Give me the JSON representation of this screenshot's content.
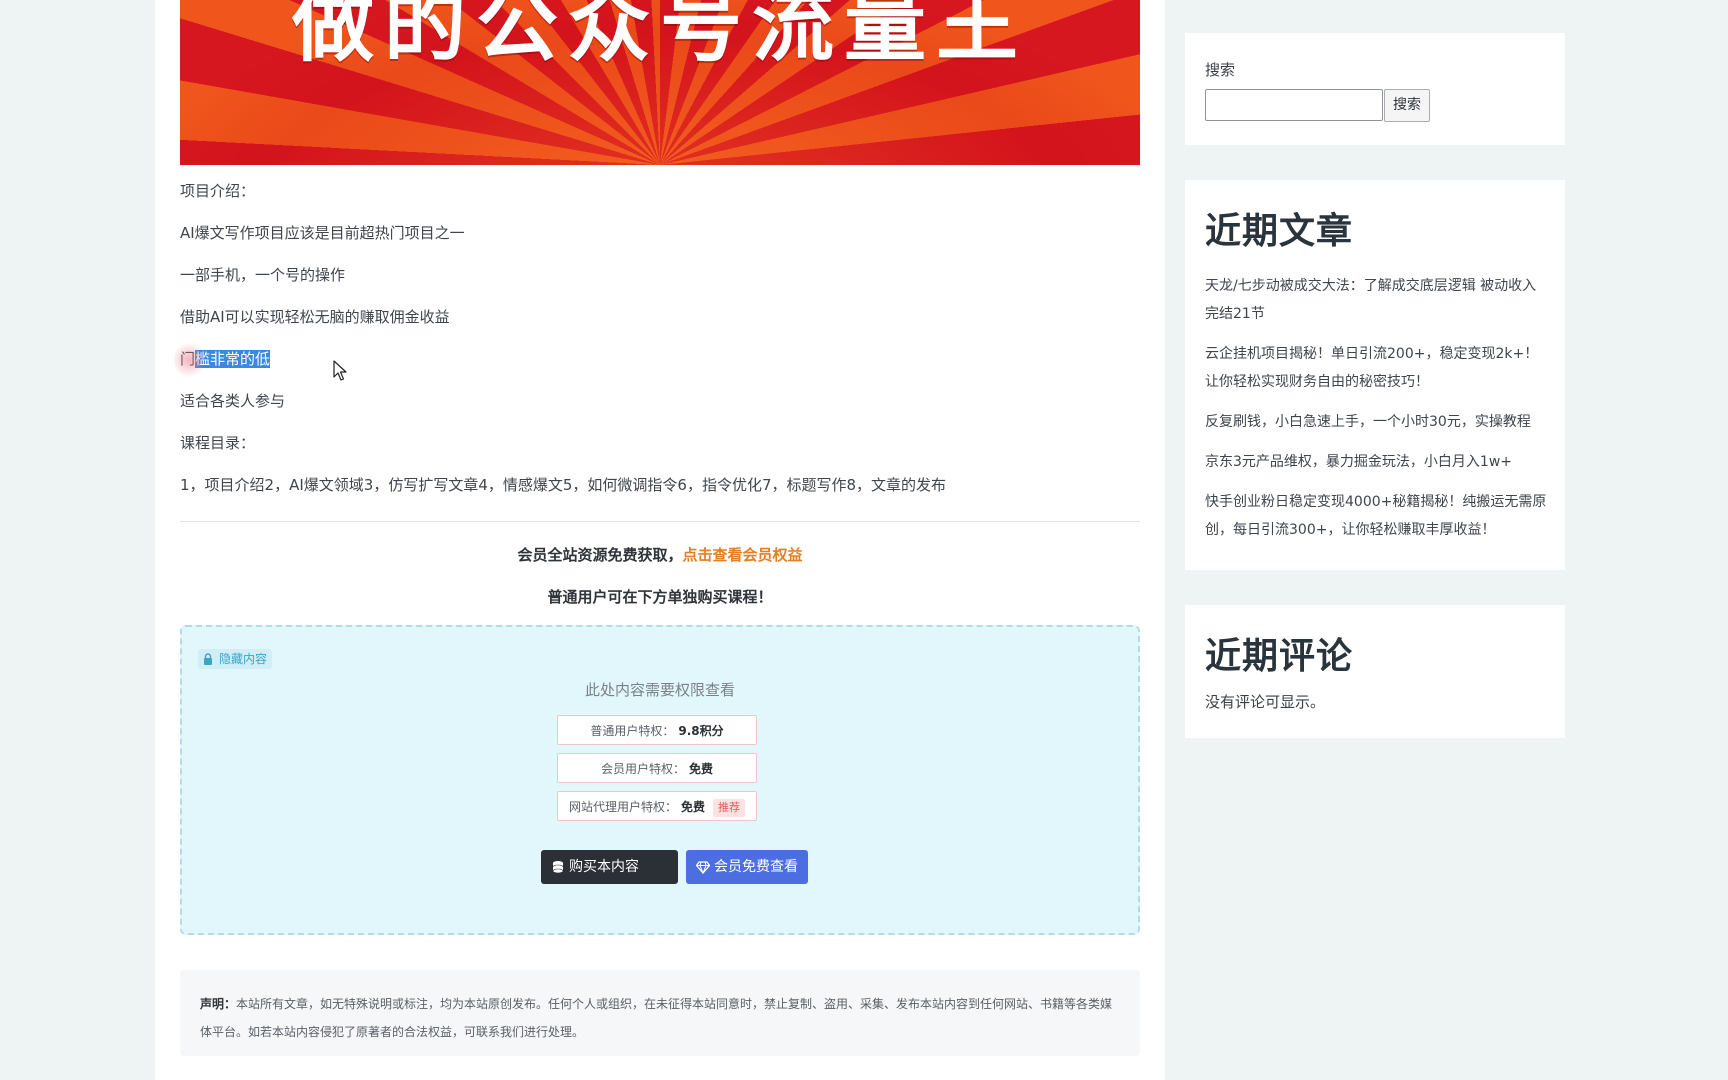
{
  "hero": {
    "title": "做的公众号流量王"
  },
  "article": {
    "paragraphs": [
      "项目介绍：",
      "AI爆文写作项目应该是目前超热门项目之一",
      "一部手机，一个号的操作",
      "借助AI可以实现轻松无脑的赚取佣金收益"
    ],
    "selected_line": {
      "prefix": "门",
      "selected": "槛非常的低"
    },
    "paragraphs_after": [
      "适合各类人参与",
      "课程目录：",
      "1，项目介绍2，AI爆文领域3，仿写扩写文章4，情感爆文5，如何微调指令6，指令优化7，标题写作8，文章的发布"
    ]
  },
  "member": {
    "line1_prefix": "会员全站资源免费获取，",
    "line1_link": "点击查看会员权益",
    "line2": "普通用户可在下方单独购买课程！"
  },
  "hidden": {
    "badge": "隐藏内容",
    "title": "此处内容需要权限查看",
    "rows": [
      {
        "label": "普通用户特权：",
        "value": "9.8积分",
        "tag": ""
      },
      {
        "label": "会员用户特权：",
        "value": "免费",
        "tag": ""
      },
      {
        "label": "网站代理用户特权：",
        "value": "免费",
        "tag": "推荐"
      }
    ],
    "buy_button": "购买本内容",
    "vip_button": "会员免费查看"
  },
  "notice": {
    "label": "声明：",
    "text": "本站所有文章，如无特殊说明或标注，均为本站原创发布。任何个人或组织，在未征得本站同意时，禁止复制、盗用、采集、发布本站内容到任何网站、书籍等各类媒体平台。如若本站内容侵犯了原著者的合法权益，可联系我们进行处理。"
  },
  "sidebar": {
    "search_label": "搜索",
    "search_placeholder": "",
    "search_button": "搜索",
    "recent_title": "近期文章",
    "recent_posts": [
      "天龙/七步动被成交大法：了解成交底层逻辑 被动收入完结21节",
      "云企挂机项目揭秘！单日引流200+，稳定变现2k+！让你轻松实现财务自由的秘密技巧！",
      "反复刷钱，小白急速上手，一个小时30元，实操教程",
      "京东3元产品维权，暴力掘金玩法，小白月入1w+",
      "快手创业粉日稳定变现4000+秘籍揭秘！纯搬运无需原创，每日引流300+，让你轻松赚取丰厚收益！"
    ],
    "comments_title": "近期评论",
    "no_comments": "没有评论可显示。"
  },
  "colors": {
    "accent_orange": "#e67e22",
    "buy_button_bg": "#2b2f36",
    "vip_button_bg": "#4d6ee0",
    "hidden_box_bg": "#e2f7fb"
  }
}
